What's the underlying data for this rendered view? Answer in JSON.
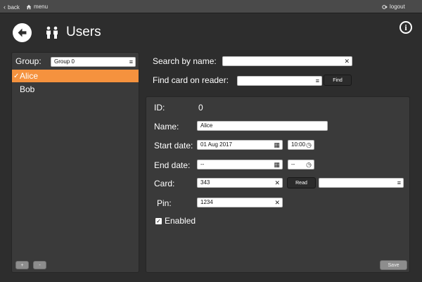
{
  "topbar": {
    "back_label": "back",
    "menu_label": "menu",
    "logout_label": "logout"
  },
  "header": {
    "title": "Users"
  },
  "left_panel": {
    "group_label": "Group:",
    "group_value": "Group 0",
    "users": [
      {
        "name": "Alice",
        "selected": true
      },
      {
        "name": "Bob",
        "selected": false
      }
    ],
    "add_label": "+",
    "remove_label": "-"
  },
  "search": {
    "label": "Search by name:",
    "value": "",
    "find_card_label": "Find card on reader:",
    "find_card_value": "",
    "find_button": "Find"
  },
  "details": {
    "id_label": "ID:",
    "id_value": "0",
    "name_label": "Name:",
    "name_value": "Alice",
    "start_date_label": "Start date:",
    "start_date_value": "01 Aug 2017",
    "start_time_value": "10:00",
    "end_date_label": "End date:",
    "end_date_value": "--",
    "end_time_value": "--",
    "card_label": "Card:",
    "card_value": "343",
    "read_button": "Read",
    "reader_value": "",
    "pin_label": "Pin:",
    "pin_value": "1234",
    "enabled_label": "Enabled",
    "enabled": true,
    "save_button": "Save"
  },
  "colors": {
    "accent": "#f5923e",
    "background": "#2d2d2d",
    "panel": "#3a3a3a",
    "topbar": "#4a4a4a"
  },
  "icons": {
    "back": "back-arrow-icon",
    "users": "users-icon",
    "info": "info-icon",
    "clear": "clear-x-icon",
    "list": "list-icon",
    "calendar": "calendar-icon",
    "clock": "clock-icon"
  }
}
